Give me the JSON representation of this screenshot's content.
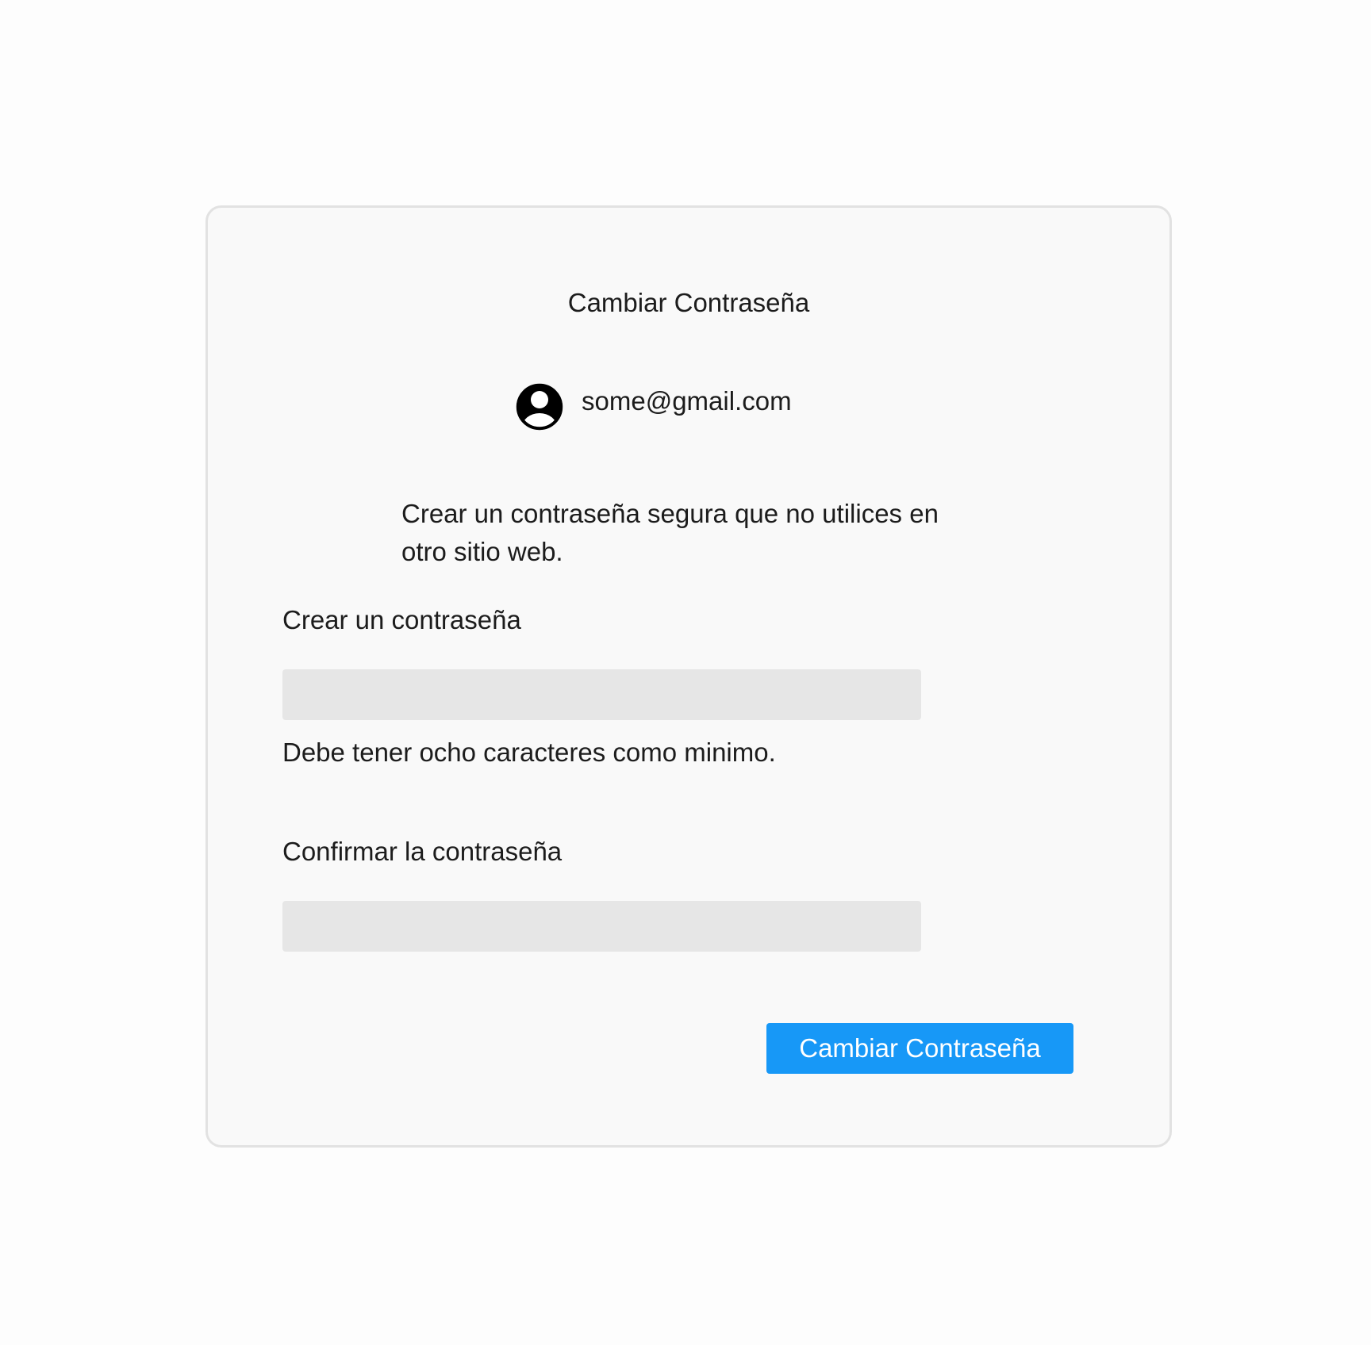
{
  "colors": {
    "page_background": "#fdfdfd",
    "card_background": "#f9f9f9",
    "card_border": "#e2e2e2",
    "input_background": "#e6e6e6",
    "primary_button": "#1798f7",
    "primary_button_text": "#ffffff",
    "text": "#1c1c1c"
  },
  "dialog": {
    "title": "Cambiar Contraseña",
    "account": {
      "icon": "user-account-icon",
      "email": "some@gmail.com"
    },
    "intro": "Crear un contraseña segura que no utilices en otro sitio web.",
    "new_password": {
      "label": "Crear un contraseña",
      "value": "",
      "placeholder": "",
      "hint": "Debe tener ocho caracteres como minimo."
    },
    "confirm_password": {
      "label": "Confirmar la contraseña",
      "value": "",
      "placeholder": ""
    },
    "submit_label": "Cambiar Contraseña"
  }
}
